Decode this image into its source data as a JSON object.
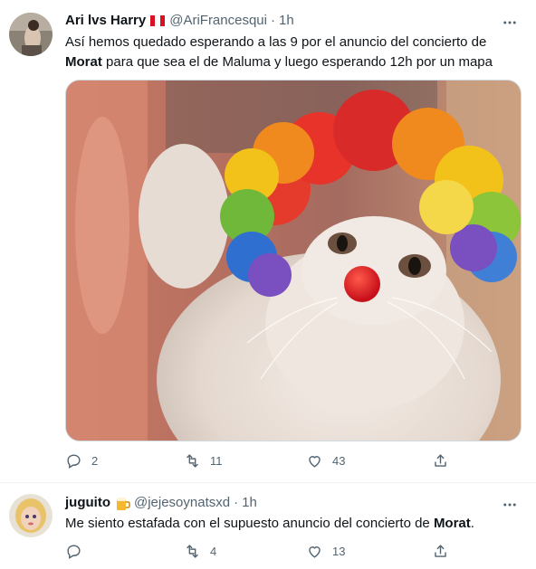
{
  "tweets": [
    {
      "name": "Ari lvs Harry",
      "badge": "peru-flag-emoji",
      "handle": "@AriFrancesqui",
      "dot": "·",
      "time": "1h",
      "text_line1": "Así hemos quedado esperando a las 9 por el anuncio del concierto de",
      "text_bold": "Morat",
      "text_line2_rest": " para que sea el de Maluma y luego esperando 12h por un mapa",
      "media_icon": "cat-clown-photo",
      "replies": "2",
      "retweets": "11",
      "likes": "43"
    },
    {
      "name": "juguito",
      "badge": "beer-emoji",
      "handle": "@jejesoynatsxd",
      "dot": "·",
      "time": "1h",
      "text_before": "Me siento estafada con el supuesto anuncio del concierto de ",
      "text_bold": "Morat",
      "text_after": ".",
      "replies": "",
      "retweets": "4",
      "likes": "13"
    }
  ],
  "icons": {
    "reply": "reply-icon",
    "retweet": "retweet-icon",
    "like": "heart-icon",
    "share": "share-icon",
    "more": "more-icon"
  },
  "colors": {
    "text": "#0f1419",
    "secondary": "#536471",
    "border": "#eff3f4"
  }
}
